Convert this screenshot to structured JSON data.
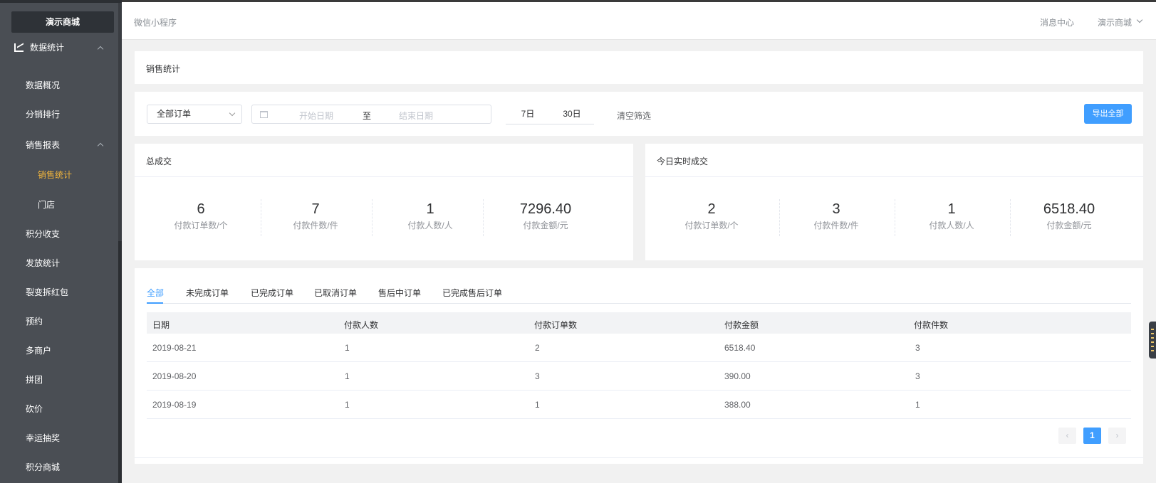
{
  "sidebar": {
    "brand": "演示商城",
    "section": "数据统计",
    "items": [
      {
        "label": "数据概况"
      },
      {
        "label": "分销排行"
      },
      {
        "label": "销售报表"
      },
      {
        "label": "销售统计"
      },
      {
        "label": "门店"
      },
      {
        "label": "积分收支"
      },
      {
        "label": "发放统计"
      },
      {
        "label": "裂变拆红包"
      },
      {
        "label": "预约"
      },
      {
        "label": "多商户"
      },
      {
        "label": "拼团"
      },
      {
        "label": "砍价"
      },
      {
        "label": "幸运抽奖"
      },
      {
        "label": "积分商城"
      }
    ],
    "active_item": "销售统计"
  },
  "header": {
    "breadcrumb": "微信小程序",
    "message_center": "消息中心",
    "shop_name": "演示商城"
  },
  "page": {
    "title": "销售统计"
  },
  "filters": {
    "order_type": "全部订单",
    "start_placeholder": "开始日期",
    "range_separator": "至",
    "end_placeholder": "结束日期",
    "quick_7": "7日",
    "quick_30": "30日",
    "clear": "清空筛选",
    "export": "导出全部"
  },
  "total_stats": {
    "title": "总成交",
    "items": [
      {
        "value": "6",
        "label": "付款订单数/个"
      },
      {
        "value": "7",
        "label": "付款件数/件"
      },
      {
        "value": "1",
        "label": "付款人数/人"
      },
      {
        "value": "7296.40",
        "label": "付款金额/元"
      }
    ]
  },
  "today_stats": {
    "title": "今日实时成交",
    "items": [
      {
        "value": "2",
        "label": "付款订单数/个"
      },
      {
        "value": "3",
        "label": "付款件数/件"
      },
      {
        "value": "1",
        "label": "付款人数/人"
      },
      {
        "value": "6518.40",
        "label": "付款金额/元"
      }
    ]
  },
  "tabs": [
    {
      "label": "全部"
    },
    {
      "label": "未完成订单"
    },
    {
      "label": "已完成订单"
    },
    {
      "label": "已取消订单"
    },
    {
      "label": "售后中订单"
    },
    {
      "label": "已完成售后订单"
    }
  ],
  "table": {
    "columns": [
      "日期",
      "付款人数",
      "付款订单数",
      "付款金额",
      "付款件数"
    ],
    "rows": [
      [
        "2019-08-21",
        "1",
        "2",
        "6518.40",
        "3"
      ],
      [
        "2019-08-20",
        "1",
        "3",
        "390.00",
        "3"
      ],
      [
        "2019-08-19",
        "1",
        "1",
        "388.00",
        "1"
      ]
    ]
  },
  "pagination": {
    "prev": "‹",
    "current": "1",
    "next": "›"
  },
  "colors": {
    "accent": "#409eff",
    "sidebar_bg": "#4a4e54",
    "active_menu": "#f4b73c"
  }
}
